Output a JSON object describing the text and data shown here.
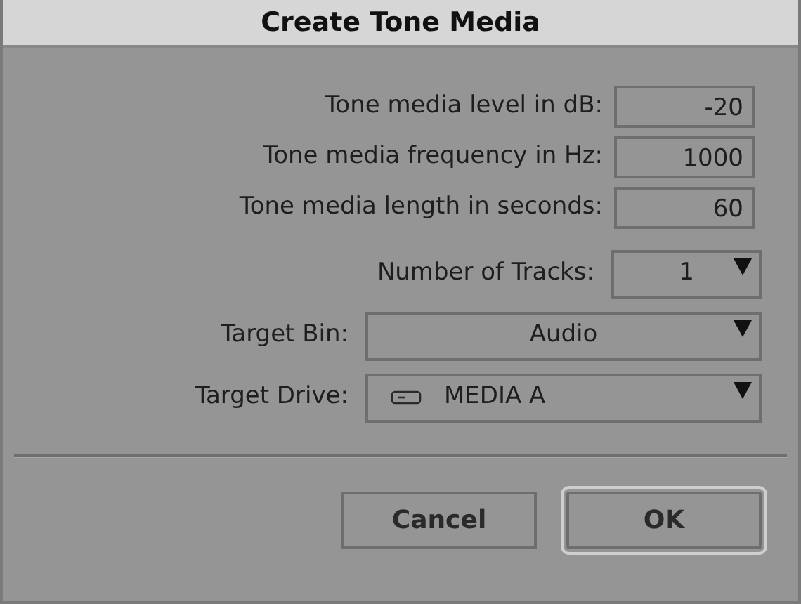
{
  "window": {
    "title": "Create Tone Media"
  },
  "fields": [
    {
      "label": "Tone media level in dB:",
      "value": "-20"
    },
    {
      "label": "Tone media frequency in Hz:",
      "value": "1000"
    },
    {
      "label": "Tone media length in seconds:",
      "value": "60"
    }
  ],
  "dropdowns": [
    {
      "kind": "short",
      "label": "Number of Tracks:",
      "value": "1"
    },
    {
      "kind": "wide",
      "label": "Target Bin:",
      "value": "Audio"
    },
    {
      "kind": "drive",
      "label": "Target Drive:",
      "value": "MEDIA A"
    }
  ],
  "buttons": [
    {
      "label": "Cancel",
      "default": false
    },
    {
      "label": "OK",
      "default": true
    }
  ]
}
